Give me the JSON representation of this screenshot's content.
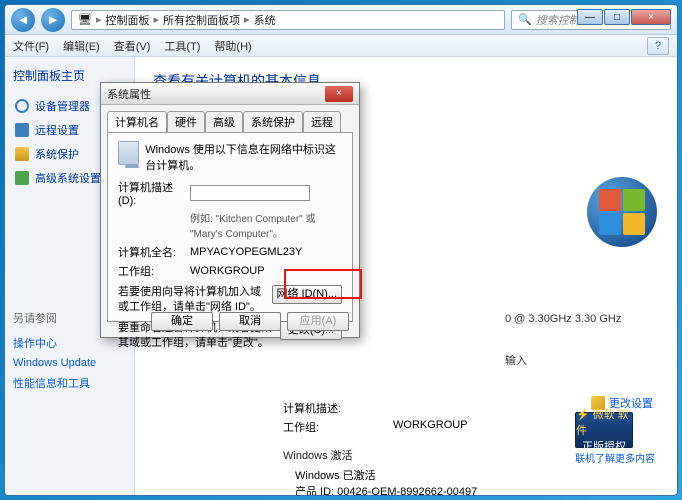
{
  "window": {
    "min": "—",
    "max": "□",
    "close": "×"
  },
  "breadcrumb": {
    "root_icon": "🖥",
    "a": "控制面板",
    "b": "所有控制面板项",
    "c": "系统"
  },
  "search": {
    "placeholder": "搜索控制面板",
    "icon": "🔍"
  },
  "menu": {
    "file": "文件(F)",
    "edit": "编辑(E)",
    "view": "查看(V)",
    "tools": "工具(T)",
    "help": "帮助(H)",
    "help_icon": "?"
  },
  "sidebar": {
    "home": "控制面板主页",
    "items": [
      {
        "icon": "gear",
        "label": "设备管理器"
      },
      {
        "icon": "remote",
        "label": "远程设置"
      },
      {
        "icon": "shield",
        "label": "系统保护"
      },
      {
        "icon": "adv",
        "label": "高级系统设置"
      }
    ],
    "also": {
      "heading": "另请参阅",
      "links": [
        "操作中心",
        "Windows Update",
        "性能信息和工具"
      ]
    }
  },
  "content": {
    "title": "查看有关计算机的基本信息",
    "cpu": "0 @ 3.30GHz   3.30 GHz",
    "input_suffix": "输入",
    "desc_label": "计算机描述:",
    "workgroup_label": "工作组:",
    "workgroup_value": "WORKGROUP",
    "activation_heading": "Windows 激活",
    "activation_status": "Windows 已激活",
    "product_id": "产品 ID: 00426-OEM-8992662-00497",
    "change_settings": "更改设置",
    "ga_top": "⚡ 微软 软件",
    "ga_mid": "正版授权",
    "ga_link": "联机了解更多内容"
  },
  "dialog": {
    "title": "系统属性",
    "close": "×",
    "tabs": [
      "计算机名",
      "硬件",
      "高级",
      "系统保护",
      "远程"
    ],
    "note": "Windows 使用以下信息在网络中标识这台计算机。",
    "desc_label": "计算机描述(D):",
    "desc_value": "",
    "example": "例如: \"Kitchen Computer\" 或 \"Mary's Computer\"。",
    "fullname_label": "计算机全名:",
    "fullname_value": "MPYACYOPEGML23Y",
    "workgroup_label": "工作组:",
    "workgroup_value": "WORKGROUP",
    "wizard_text": "若要使用向导将计算机加入域或工作组，请单击\"网络 ID\"。",
    "network_id_btn": "网络 ID(N)...",
    "rename_text": "要重命名这台计算机，或者更改其域或工作组，请单击\"更改\"。",
    "change_btn": "更改(C)...",
    "ok": "确定",
    "cancel": "取消",
    "apply": "应用(A)"
  }
}
